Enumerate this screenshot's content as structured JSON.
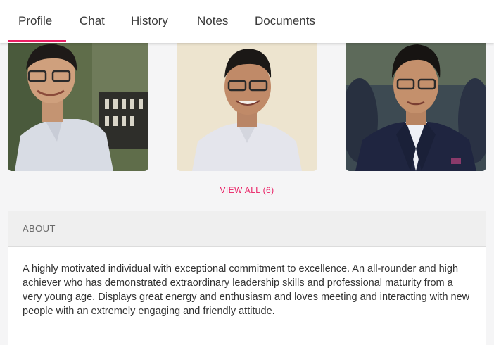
{
  "tabs": [
    {
      "label": "Profile",
      "active": true
    },
    {
      "label": "Chat",
      "active": false
    },
    {
      "label": "History",
      "active": false
    },
    {
      "label": "Notes",
      "active": false
    },
    {
      "label": "Documents",
      "active": false
    }
  ],
  "accent_color": "#e91e63",
  "gallery": {
    "photos": [
      {
        "description": "profile-photo-1"
      },
      {
        "description": "profile-photo-2"
      },
      {
        "description": "profile-photo-3"
      }
    ],
    "view_all_label": "VIEW ALL (6)"
  },
  "about": {
    "title": "ABOUT",
    "text": "A highly motivated individual with exceptional commitment to excellence. An all-rounder and high achiever who has demonstrated extraordinary leadership skills and professional maturity from a very young age. Displays great energy and enthusiasm and loves meeting and interacting with new people with an extremely engaging and friendly attitude."
  }
}
